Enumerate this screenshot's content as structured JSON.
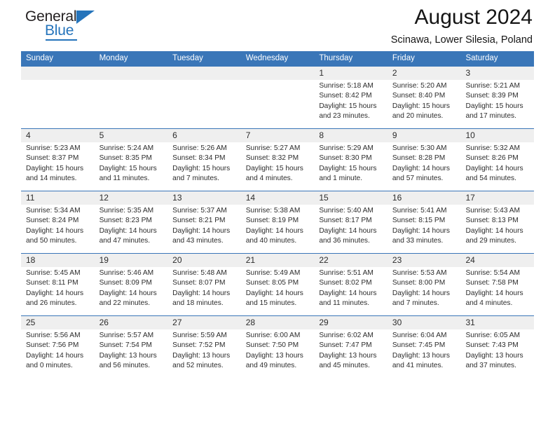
{
  "brand": {
    "name_part1": "General",
    "name_part2": "Blue",
    "accent_color": "#2574bb"
  },
  "header": {
    "title": "August 2024",
    "location": "Scinawa, Lower Silesia, Poland"
  },
  "theme": {
    "header_bar_color": "#3a76b8",
    "daynum_band_color": "#efefef",
    "text_color": "#2c2c2c"
  },
  "weekday_headers": [
    "Sunday",
    "Monday",
    "Tuesday",
    "Wednesday",
    "Thursday",
    "Friday",
    "Saturday"
  ],
  "weeks": [
    [
      {
        "day": "",
        "sunrise": "",
        "sunset": "",
        "daylight1": "",
        "daylight2": ""
      },
      {
        "day": "",
        "sunrise": "",
        "sunset": "",
        "daylight1": "",
        "daylight2": ""
      },
      {
        "day": "",
        "sunrise": "",
        "sunset": "",
        "daylight1": "",
        "daylight2": ""
      },
      {
        "day": "",
        "sunrise": "",
        "sunset": "",
        "daylight1": "",
        "daylight2": ""
      },
      {
        "day": "1",
        "sunrise": "Sunrise: 5:18 AM",
        "sunset": "Sunset: 8:42 PM",
        "daylight1": "Daylight: 15 hours",
        "daylight2": "and 23 minutes."
      },
      {
        "day": "2",
        "sunrise": "Sunrise: 5:20 AM",
        "sunset": "Sunset: 8:40 PM",
        "daylight1": "Daylight: 15 hours",
        "daylight2": "and 20 minutes."
      },
      {
        "day": "3",
        "sunrise": "Sunrise: 5:21 AM",
        "sunset": "Sunset: 8:39 PM",
        "daylight1": "Daylight: 15 hours",
        "daylight2": "and 17 minutes."
      }
    ],
    [
      {
        "day": "4",
        "sunrise": "Sunrise: 5:23 AM",
        "sunset": "Sunset: 8:37 PM",
        "daylight1": "Daylight: 15 hours",
        "daylight2": "and 14 minutes."
      },
      {
        "day": "5",
        "sunrise": "Sunrise: 5:24 AM",
        "sunset": "Sunset: 8:35 PM",
        "daylight1": "Daylight: 15 hours",
        "daylight2": "and 11 minutes."
      },
      {
        "day": "6",
        "sunrise": "Sunrise: 5:26 AM",
        "sunset": "Sunset: 8:34 PM",
        "daylight1": "Daylight: 15 hours",
        "daylight2": "and 7 minutes."
      },
      {
        "day": "7",
        "sunrise": "Sunrise: 5:27 AM",
        "sunset": "Sunset: 8:32 PM",
        "daylight1": "Daylight: 15 hours",
        "daylight2": "and 4 minutes."
      },
      {
        "day": "8",
        "sunrise": "Sunrise: 5:29 AM",
        "sunset": "Sunset: 8:30 PM",
        "daylight1": "Daylight: 15 hours",
        "daylight2": "and 1 minute."
      },
      {
        "day": "9",
        "sunrise": "Sunrise: 5:30 AM",
        "sunset": "Sunset: 8:28 PM",
        "daylight1": "Daylight: 14 hours",
        "daylight2": "and 57 minutes."
      },
      {
        "day": "10",
        "sunrise": "Sunrise: 5:32 AM",
        "sunset": "Sunset: 8:26 PM",
        "daylight1": "Daylight: 14 hours",
        "daylight2": "and 54 minutes."
      }
    ],
    [
      {
        "day": "11",
        "sunrise": "Sunrise: 5:34 AM",
        "sunset": "Sunset: 8:24 PM",
        "daylight1": "Daylight: 14 hours",
        "daylight2": "and 50 minutes."
      },
      {
        "day": "12",
        "sunrise": "Sunrise: 5:35 AM",
        "sunset": "Sunset: 8:23 PM",
        "daylight1": "Daylight: 14 hours",
        "daylight2": "and 47 minutes."
      },
      {
        "day": "13",
        "sunrise": "Sunrise: 5:37 AM",
        "sunset": "Sunset: 8:21 PM",
        "daylight1": "Daylight: 14 hours",
        "daylight2": "and 43 minutes."
      },
      {
        "day": "14",
        "sunrise": "Sunrise: 5:38 AM",
        "sunset": "Sunset: 8:19 PM",
        "daylight1": "Daylight: 14 hours",
        "daylight2": "and 40 minutes."
      },
      {
        "day": "15",
        "sunrise": "Sunrise: 5:40 AM",
        "sunset": "Sunset: 8:17 PM",
        "daylight1": "Daylight: 14 hours",
        "daylight2": "and 36 minutes."
      },
      {
        "day": "16",
        "sunrise": "Sunrise: 5:41 AM",
        "sunset": "Sunset: 8:15 PM",
        "daylight1": "Daylight: 14 hours",
        "daylight2": "and 33 minutes."
      },
      {
        "day": "17",
        "sunrise": "Sunrise: 5:43 AM",
        "sunset": "Sunset: 8:13 PM",
        "daylight1": "Daylight: 14 hours",
        "daylight2": "and 29 minutes."
      }
    ],
    [
      {
        "day": "18",
        "sunrise": "Sunrise: 5:45 AM",
        "sunset": "Sunset: 8:11 PM",
        "daylight1": "Daylight: 14 hours",
        "daylight2": "and 26 minutes."
      },
      {
        "day": "19",
        "sunrise": "Sunrise: 5:46 AM",
        "sunset": "Sunset: 8:09 PM",
        "daylight1": "Daylight: 14 hours",
        "daylight2": "and 22 minutes."
      },
      {
        "day": "20",
        "sunrise": "Sunrise: 5:48 AM",
        "sunset": "Sunset: 8:07 PM",
        "daylight1": "Daylight: 14 hours",
        "daylight2": "and 18 minutes."
      },
      {
        "day": "21",
        "sunrise": "Sunrise: 5:49 AM",
        "sunset": "Sunset: 8:05 PM",
        "daylight1": "Daylight: 14 hours",
        "daylight2": "and 15 minutes."
      },
      {
        "day": "22",
        "sunrise": "Sunrise: 5:51 AM",
        "sunset": "Sunset: 8:02 PM",
        "daylight1": "Daylight: 14 hours",
        "daylight2": "and 11 minutes."
      },
      {
        "day": "23",
        "sunrise": "Sunrise: 5:53 AM",
        "sunset": "Sunset: 8:00 PM",
        "daylight1": "Daylight: 14 hours",
        "daylight2": "and 7 minutes."
      },
      {
        "day": "24",
        "sunrise": "Sunrise: 5:54 AM",
        "sunset": "Sunset: 7:58 PM",
        "daylight1": "Daylight: 14 hours",
        "daylight2": "and 4 minutes."
      }
    ],
    [
      {
        "day": "25",
        "sunrise": "Sunrise: 5:56 AM",
        "sunset": "Sunset: 7:56 PM",
        "daylight1": "Daylight: 14 hours",
        "daylight2": "and 0 minutes."
      },
      {
        "day": "26",
        "sunrise": "Sunrise: 5:57 AM",
        "sunset": "Sunset: 7:54 PM",
        "daylight1": "Daylight: 13 hours",
        "daylight2": "and 56 minutes."
      },
      {
        "day": "27",
        "sunrise": "Sunrise: 5:59 AM",
        "sunset": "Sunset: 7:52 PM",
        "daylight1": "Daylight: 13 hours",
        "daylight2": "and 52 minutes."
      },
      {
        "day": "28",
        "sunrise": "Sunrise: 6:00 AM",
        "sunset": "Sunset: 7:50 PM",
        "daylight1": "Daylight: 13 hours",
        "daylight2": "and 49 minutes."
      },
      {
        "day": "29",
        "sunrise": "Sunrise: 6:02 AM",
        "sunset": "Sunset: 7:47 PM",
        "daylight1": "Daylight: 13 hours",
        "daylight2": "and 45 minutes."
      },
      {
        "day": "30",
        "sunrise": "Sunrise: 6:04 AM",
        "sunset": "Sunset: 7:45 PM",
        "daylight1": "Daylight: 13 hours",
        "daylight2": "and 41 minutes."
      },
      {
        "day": "31",
        "sunrise": "Sunrise: 6:05 AM",
        "sunset": "Sunset: 7:43 PM",
        "daylight1": "Daylight: 13 hours",
        "daylight2": "and 37 minutes."
      }
    ]
  ]
}
